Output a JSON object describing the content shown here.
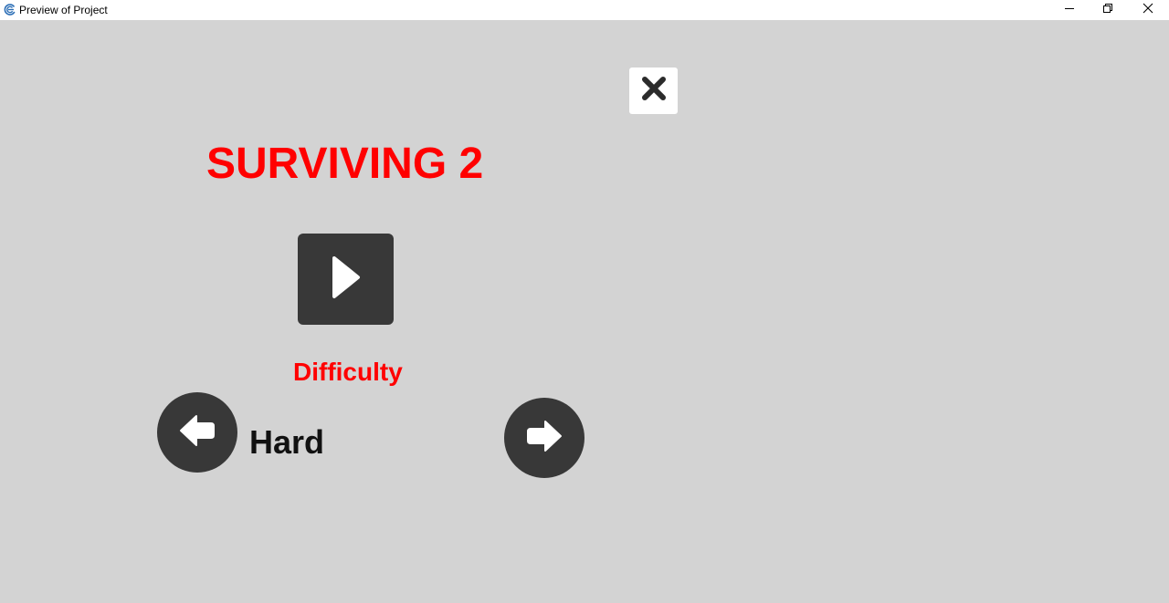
{
  "window": {
    "title": "Preview of Project",
    "icon": "app-logo-icon",
    "controls": [
      "minimize-icon",
      "maximize-icon",
      "close-icon"
    ]
  },
  "game": {
    "title": "SURVIVING 2",
    "difficulty_label": "Difficulty",
    "difficulty_value": "Hard",
    "buttons": {
      "close": "close-x-icon",
      "play": "play-icon",
      "previous": "arrow-left-icon",
      "next": "arrow-right-icon"
    }
  },
  "colors": {
    "background": "#d3d3d3",
    "title_red": "#ff0000",
    "button_dark": "#383838",
    "button_glyph": "#ffffff"
  }
}
